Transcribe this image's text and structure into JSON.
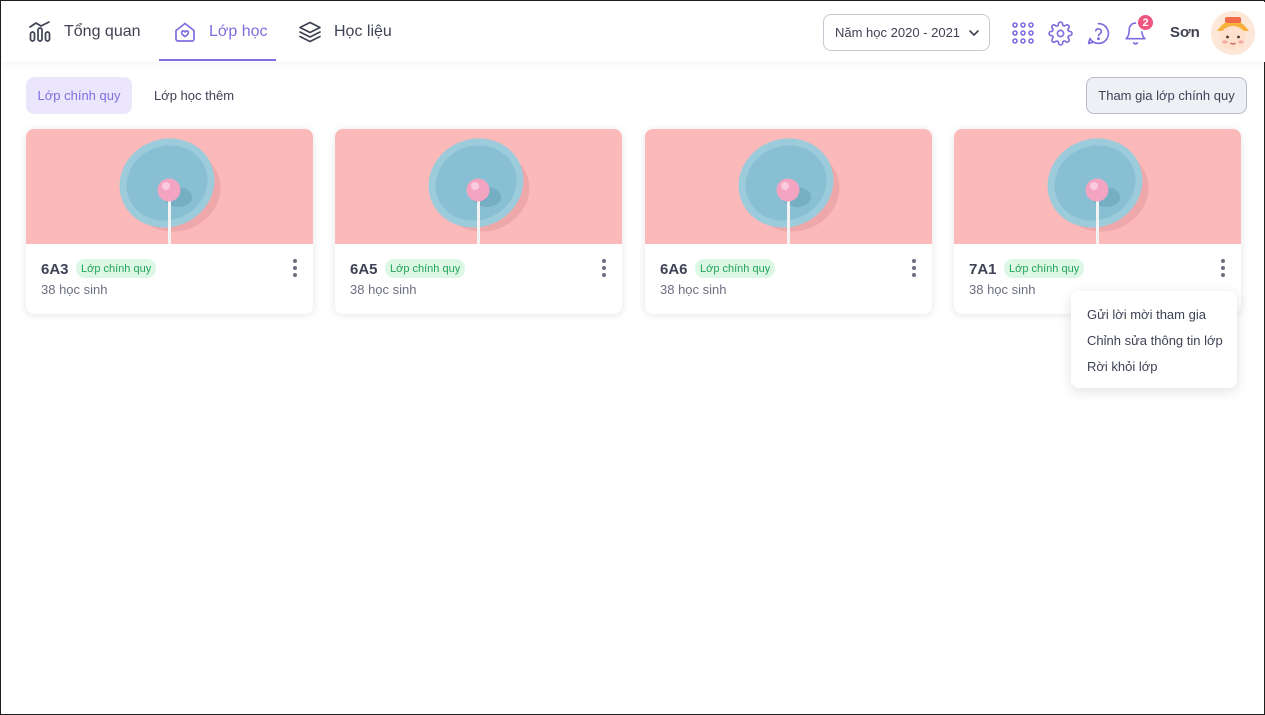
{
  "nav": {
    "items": [
      {
        "label": "Tổng quan",
        "icon": "chart-icon"
      },
      {
        "label": "Lớp học",
        "icon": "home-heart-icon",
        "active": true
      },
      {
        "label": "Học liệu",
        "icon": "layers-icon"
      }
    ],
    "accent_color": "#7e6ee0"
  },
  "header": {
    "year_select": {
      "value": "Năm học 2020 - 2021"
    },
    "notifications_count": "2",
    "username": "Sơn",
    "icons": [
      "apps-grid-icon",
      "settings-icon",
      "help-icon",
      "bell-icon",
      "avatar"
    ]
  },
  "subtabs": [
    {
      "label": "Lớp chính quy",
      "active": true
    },
    {
      "label": "Lớp học thêm",
      "active": false
    }
  ],
  "join_button": {
    "label": "Tham gia lớp chính quy"
  },
  "classes": [
    {
      "name": "6A3",
      "tag": "Lớp chính quy",
      "students": "38 học sinh"
    },
    {
      "name": "6A5",
      "tag": "Lớp chính quy",
      "students": "38 học sinh"
    },
    {
      "name": "6A6",
      "tag": "Lớp chính quy",
      "students": "38 học sinh"
    },
    {
      "name": "7A1",
      "tag": "Lớp chính quy",
      "students": "38 học sinh"
    }
  ],
  "class_menu": {
    "items": [
      {
        "label": "Gửi lời mời tham gia"
      },
      {
        "label": "Chỉnh sửa thông tin lớp"
      },
      {
        "label": "Rời khỏi lớp"
      }
    ]
  },
  "colors": {
    "tag_bg": "#dcf7e4",
    "tag_text": "#21a55a",
    "badge": "#f0557f",
    "cover_bg": "#fbb9b9"
  }
}
